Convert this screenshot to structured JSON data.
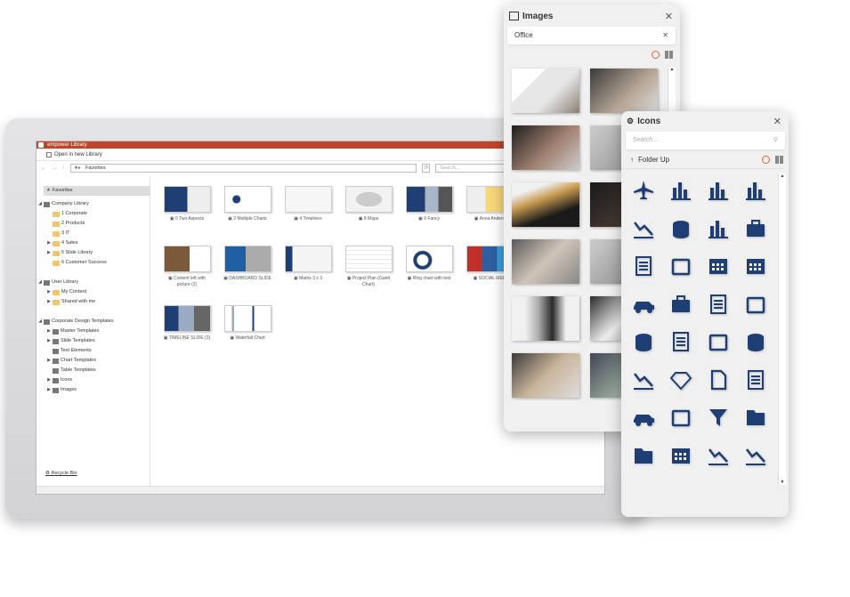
{
  "library": {
    "title": "empower Library",
    "open_new_label": "Open in new Library",
    "address": "Favorites",
    "search_placeholder": "Search...",
    "favorites_label": "Favorites",
    "tree": [
      {
        "label": "Company Library",
        "level": 0,
        "arrow": "open",
        "icon": "library"
      },
      {
        "label": "1 Corporate",
        "level": 1,
        "arrow": "",
        "icon": "folder"
      },
      {
        "label": "2 Products",
        "level": 1,
        "arrow": "",
        "icon": "folder"
      },
      {
        "label": "3 IT",
        "level": 1,
        "arrow": "",
        "icon": "folder"
      },
      {
        "label": "4 Sales",
        "level": 1,
        "arrow": "closed",
        "icon": "folder"
      },
      {
        "label": "5 Slide Library",
        "level": 1,
        "arrow": "closed",
        "icon": "folder"
      },
      {
        "label": "6 Customer Success",
        "level": 1,
        "arrow": "",
        "icon": "folder"
      },
      {
        "label": "",
        "level": -1
      },
      {
        "label": "User Library",
        "level": 0,
        "arrow": "open",
        "icon": "user"
      },
      {
        "label": "My Content",
        "level": 1,
        "arrow": "closed",
        "icon": "folder"
      },
      {
        "label": "Shared with me",
        "level": 1,
        "arrow": "closed",
        "icon": "folder"
      },
      {
        "label": "",
        "level": -1
      },
      {
        "label": "Corporate Design Templates",
        "level": 0,
        "arrow": "open",
        "icon": "templates"
      },
      {
        "label": "Master Templates",
        "level": 1,
        "arrow": "closed",
        "icon": "item"
      },
      {
        "label": "Slide Templates",
        "level": 1,
        "arrow": "closed",
        "icon": "item"
      },
      {
        "label": "Text Elements",
        "level": 1,
        "arrow": "",
        "icon": "item"
      },
      {
        "label": "Chart Templates",
        "level": 1,
        "arrow": "closed",
        "icon": "item"
      },
      {
        "label": "Table Templates",
        "level": 1,
        "arrow": "",
        "icon": "item"
      },
      {
        "label": "Icons",
        "level": 1,
        "arrow": "closed",
        "icon": "item"
      },
      {
        "label": "Images",
        "level": 1,
        "arrow": "closed",
        "icon": "item"
      }
    ],
    "recycle_bin": "Recycle Bin",
    "slides": [
      {
        "label": "0 Two Aspects",
        "style": "navy"
      },
      {
        "label": "2 Multiple Charts",
        "style": "rings"
      },
      {
        "label": "4 Timelines",
        "style": "light"
      },
      {
        "label": "8 Maps",
        "style": "map"
      },
      {
        "label": "9 Fancy",
        "style": "fancy"
      },
      {
        "label": "Anna Anders",
        "style": "yellow"
      },
      {
        "label": "Content left with picture (2)",
        "style": "city"
      },
      {
        "label": "DASHBOARD SLIDE",
        "style": "dash"
      },
      {
        "label": "Matrix 3 x 3",
        "style": "matrix"
      },
      {
        "label": "Project Plan (Gantt Chart)",
        "style": "gantt"
      },
      {
        "label": "Ring chart with text",
        "style": "ring"
      },
      {
        "label": "SOCIAL MED",
        "style": "social"
      },
      {
        "label": "TIMELINE SLIDE (3)",
        "style": "diamond"
      },
      {
        "label": "Waterfall Chart",
        "style": "waterfall"
      }
    ]
  },
  "images_panel": {
    "title": "Images",
    "search_value": "Office",
    "thumbnails": [
      "office-desk-clock",
      "meeting-hands",
      "laptop-hands",
      "office-person",
      "sticky-notes",
      "office-window",
      "meeting-table",
      "laptop-desk",
      "office-plant",
      "coffee-cup",
      "meeting-papers",
      "office-interior"
    ]
  },
  "icons_panel": {
    "title": "Icons",
    "search_placeholder": "Search...",
    "folder_up": "Folder Up",
    "accent": "#1f3f74",
    "icons": [
      "airplane",
      "bar-chart",
      "bar-chart-down",
      "bar-chart-up",
      "bicycle",
      "books-stack",
      "bookshelf",
      "briefcase",
      "checklist",
      "calendar",
      "calendar-grid",
      "calendar-full",
      "car",
      "cash-register",
      "clipboard-check",
      "clipboard",
      "coins",
      "document-image",
      "credit-card",
      "database",
      "chart-decline",
      "diamond",
      "file",
      "file-text",
      "car-move",
      "id-card",
      "filter",
      "folder",
      "folder-open",
      "hierarchy",
      "hand-truck",
      "line-chart-up"
    ]
  }
}
